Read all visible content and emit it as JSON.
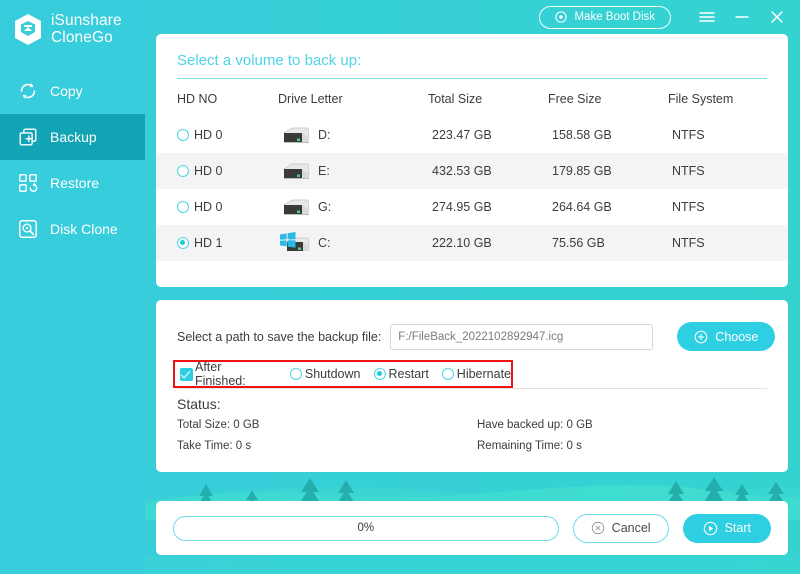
{
  "app": {
    "brand_line1": "iSunshare",
    "brand_line2": "CloneGo",
    "logo_icon": "hexagon-shield-logo"
  },
  "colors": {
    "brand_teal": "#38cddd",
    "accent": "#2ecfe2",
    "active_nav": "#12a4b4",
    "annotation_red": "#ef1414",
    "title_text": "#4ed4e6"
  },
  "topbar": {
    "boot_disk_label": "Make Boot Disk",
    "boot_disk_icon": "disc-icon",
    "menu_icon": "hamburger-menu-icon",
    "minimize_icon": "minimize-icon",
    "close_icon": "close-icon"
  },
  "sidebar": {
    "items": [
      {
        "label": "Copy",
        "icon": "refresh-circular-arrows-icon",
        "active": false
      },
      {
        "label": "Backup",
        "icon": "stacked-squares-plus-icon",
        "active": true
      },
      {
        "label": "Restore",
        "icon": "grid-restore-icon",
        "active": false
      },
      {
        "label": "Disk Clone",
        "icon": "disk-magnifier-icon",
        "active": false
      }
    ]
  },
  "volume_panel": {
    "title": "Select a volume to back up:",
    "columns": [
      "HD NO",
      "Drive Letter",
      "Total Size",
      "Free Size",
      "File System"
    ],
    "rows": [
      {
        "hd_no": "HD 0",
        "drive_letter": "D:",
        "total_size": "223.47 GB",
        "free_size": "158.58 GB",
        "file_system": "NTFS",
        "selected": false,
        "icon": "hard-drive-icon"
      },
      {
        "hd_no": "HD 0",
        "drive_letter": "E:",
        "total_size": "432.53 GB",
        "free_size": "179.85 GB",
        "file_system": "NTFS",
        "selected": false,
        "icon": "hard-drive-icon"
      },
      {
        "hd_no": "HD 0",
        "drive_letter": "G:",
        "total_size": "274.95 GB",
        "free_size": "264.64 GB",
        "file_system": "NTFS",
        "selected": false,
        "icon": "hard-drive-icon"
      },
      {
        "hd_no": "HD 1",
        "drive_letter": "C:",
        "total_size": "222.10 GB",
        "free_size": "75.56 GB",
        "file_system": "NTFS",
        "selected": true,
        "icon": "hard-drive-windows-icon"
      }
    ]
  },
  "options_panel": {
    "path_label": "Select a path to save the backup file:",
    "path_value": "F:/FileBack_2022102892947.icg",
    "path_placeholder": "",
    "choose_label": "Choose",
    "choose_icon": "plus-circle-icon",
    "after_finished_label": "After Finished:",
    "after_finished_checked": true,
    "after_options": [
      {
        "label": "Shutdown",
        "selected": false
      },
      {
        "label": "Restart",
        "selected": true
      },
      {
        "label": "Hibernate",
        "selected": false
      }
    ],
    "status_title": "Status:",
    "status_fields": [
      {
        "label": "Total Size: 0 GB"
      },
      {
        "label": "Have backed up: 0 GB"
      },
      {
        "label": "Take Time: 0 s"
      },
      {
        "label": "Remaining Time: 0 s"
      }
    ]
  },
  "actions_panel": {
    "progress_text": "0%",
    "progress_percent": 0,
    "cancel_label": "Cancel",
    "cancel_icon": "x-circle-icon",
    "start_label": "Start",
    "start_icon": "play-circle-icon"
  }
}
